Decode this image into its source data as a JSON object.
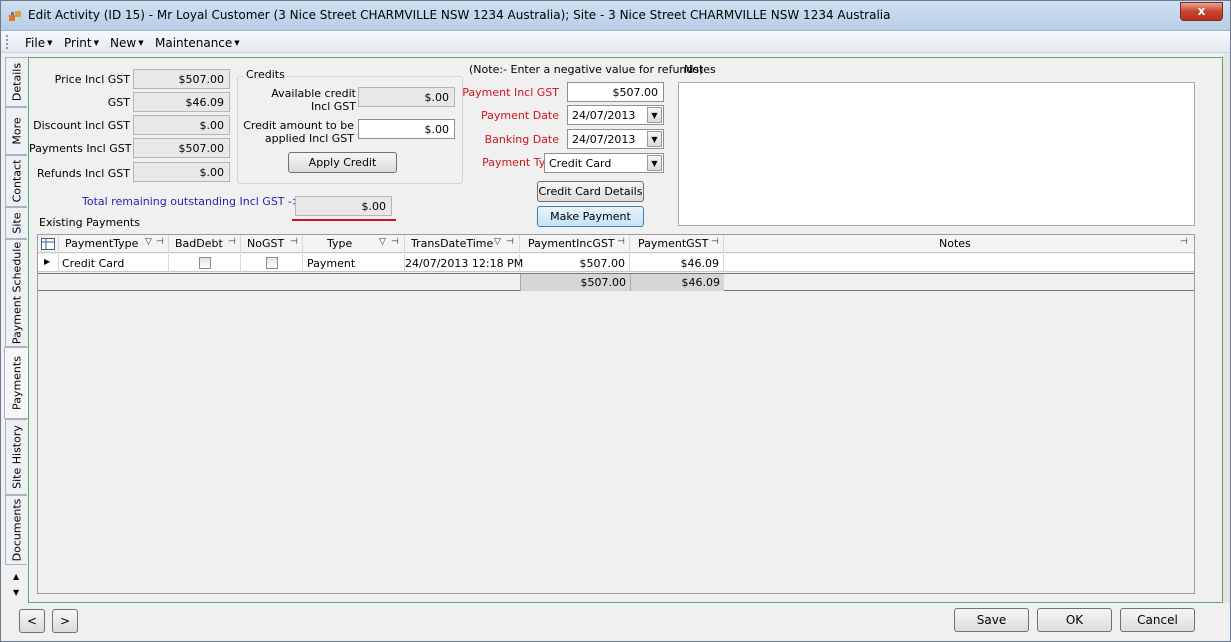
{
  "window": {
    "title": "Edit Activity (ID 15)  -  Mr Loyal Customer (3 Nice Street CHARMVILLE  NSW 1234 Australia); Site - 3 Nice Street CHARMVILLE  NSW 1234 Australia",
    "close_label": "x"
  },
  "menu": [
    "File",
    "Print",
    "New",
    "Maintenance"
  ],
  "side_tabs": [
    "Details",
    "More",
    "Contact",
    "Site",
    "Payment Schedule",
    "Payments",
    "Site History",
    "Documents"
  ],
  "summary": {
    "price_label": "Price Incl GST",
    "price_value": "$507.00",
    "gst_label": "GST",
    "gst_value": "$46.09",
    "discount_label": "Discount Incl GST",
    "discount_value": "$.00",
    "payments_label": "Payments Incl GST",
    "payments_value": "$507.00",
    "refunds_label": "Refunds Incl GST",
    "refunds_value": "$.00",
    "total_label": "Total remaining outstanding Incl GST ->",
    "total_value": "$.00"
  },
  "credits": {
    "title": "Credits",
    "available_label_1": "Available credit",
    "available_label_2": "Incl GST",
    "available_value": "$.00",
    "apply_label_1": "Credit amount to be",
    "apply_label_2": "applied Incl GST",
    "apply_value": "$.00",
    "apply_button": "Apply Credit"
  },
  "payment_form": {
    "note": "(Note:- Enter a negative value for refunds)",
    "amount_label": "Payment Incl GST",
    "amount_value": "$507.00",
    "date_label": "Payment Date",
    "date_value": "24/07/2013",
    "banking_label": "Banking Date",
    "banking_value": "24/07/2013",
    "type_label": "Payment Type",
    "type_value": "Credit Card",
    "card_details_button": "Credit Card Details",
    "make_payment_button": "Make Payment"
  },
  "notes": {
    "label": "Notes",
    "value": ""
  },
  "existing_payments": {
    "title": "Existing Payments",
    "columns": [
      "PaymentType",
      "BadDebt",
      "NoGST",
      "Type",
      "TransDateTime",
      "PaymentIncGST",
      "PaymentGST",
      "Notes"
    ],
    "rows": [
      {
        "payment_type": "Credit Card",
        "bad_debt": false,
        "no_gst": false,
        "type": "Payment",
        "trans_date_time": "24/07/2013 12:18 PM",
        "payment_inc_gst": "$507.00",
        "payment_gst": "$46.09",
        "notes": ""
      }
    ],
    "totals": {
      "payment_inc_gst": "$507.00",
      "payment_gst": "$46.09"
    }
  },
  "footer": {
    "prev": "<",
    "next": ">",
    "save": "Save",
    "ok": "OK",
    "cancel": "Cancel"
  },
  "colors": {
    "required_label": "#d0141a",
    "total_label": "#2227b3",
    "tab_border": "#5aa57a"
  }
}
